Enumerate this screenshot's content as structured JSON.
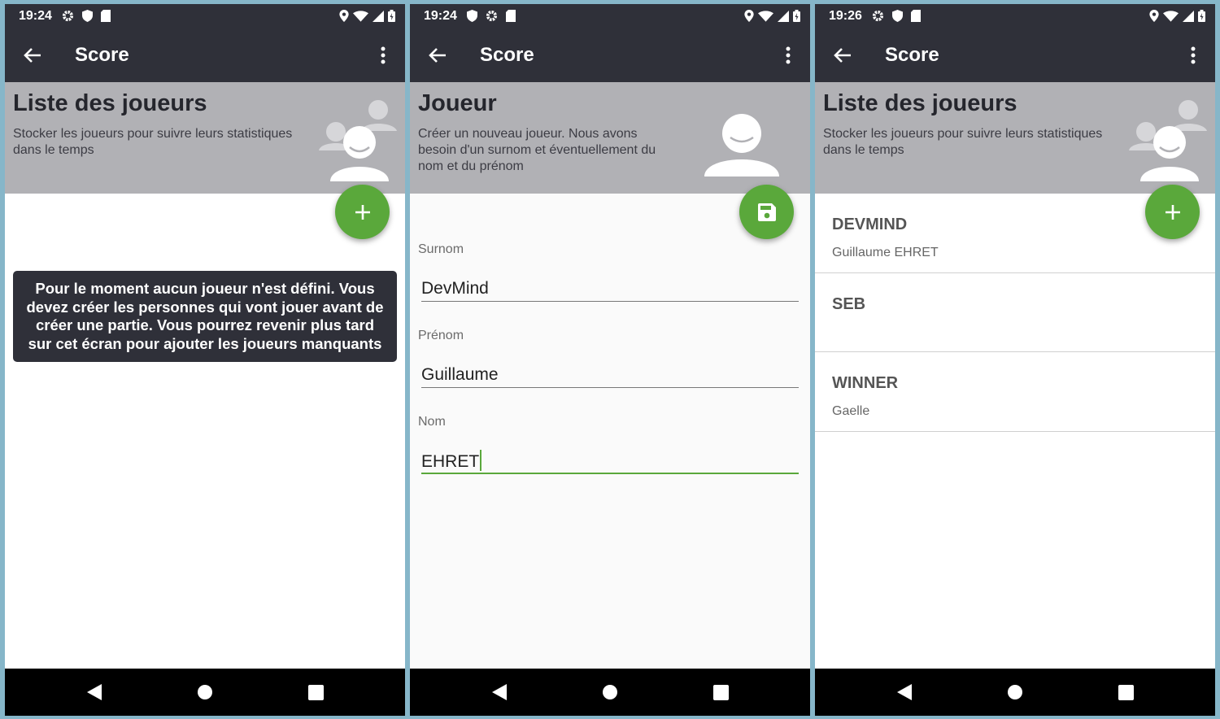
{
  "status_bars": [
    {
      "time": "19:24"
    },
    {
      "time": "19:24"
    },
    {
      "time": "19:26"
    }
  ],
  "app_title": "Score",
  "screen1": {
    "header": {
      "title": "Liste des joueurs",
      "description": "Stocker les joueurs pour suivre leurs statistiques dans le temps"
    },
    "fab_icon": "plus-icon",
    "empty_message": "Pour le moment aucun joueur n'est défini. Vous devez créer les personnes qui vont jouer avant de créer une partie. Vous pourrez revenir plus tard sur cet écran pour ajouter les joueurs manquants"
  },
  "screen2": {
    "header": {
      "title": "Joueur",
      "description": "Créer un nouveau joueur. Nous avons besoin d'un surnom et éventuellement du nom et du prénom"
    },
    "fab_icon": "save-icon",
    "fields": {
      "nickname": {
        "label": "Surnom",
        "value": "DevMind"
      },
      "firstname": {
        "label": "Prénom",
        "value": "Guillaume"
      },
      "lastname": {
        "label": "Nom",
        "value": "EHRET"
      }
    }
  },
  "screen3": {
    "header": {
      "title": "Liste des joueurs",
      "description": "Stocker les joueurs pour suivre leurs statistiques dans le temps"
    },
    "fab_icon": "plus-icon",
    "players": [
      {
        "nickname": "DEVMIND",
        "fullname": "Guillaume EHRET"
      },
      {
        "nickname": "SEB",
        "fullname": ""
      },
      {
        "nickname": "WINNER",
        "fullname": "Gaelle"
      }
    ]
  },
  "colors": {
    "toolbar": "#2f3039",
    "header": "#b1b1b5",
    "accent": "#5aa83b",
    "background": "#86b6c9"
  }
}
